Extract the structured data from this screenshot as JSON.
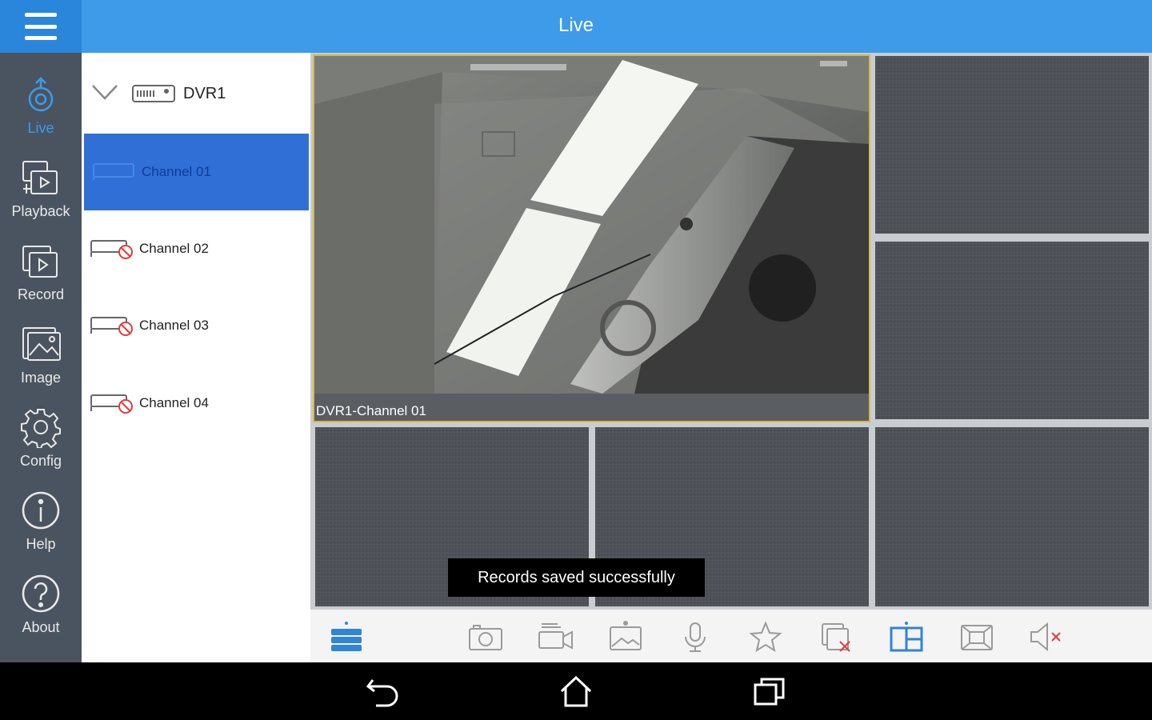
{
  "header": {
    "title": "Live"
  },
  "sidebar": {
    "items": [
      {
        "label": "Live",
        "icon": "camera-icon",
        "active": true
      },
      {
        "label": "Playback",
        "icon": "playback-icon"
      },
      {
        "label": "Record",
        "icon": "record-icon"
      },
      {
        "label": "Image",
        "icon": "image-icon"
      },
      {
        "label": "Config",
        "icon": "gear-icon"
      },
      {
        "label": "Help",
        "icon": "info-icon"
      },
      {
        "label": "About",
        "icon": "question-icon"
      }
    ]
  },
  "device_list": {
    "dvr_name": "DVR1",
    "channels": [
      {
        "name": "Channel 01",
        "selected": true
      },
      {
        "name": "Channel 02",
        "offline": true
      },
      {
        "name": "Channel 03",
        "offline": true
      },
      {
        "name": "Channel 04",
        "offline": true
      }
    ]
  },
  "video": {
    "main_caption": "DVR1-Channel 01"
  },
  "toast": {
    "message": "Records saved successfully"
  },
  "toolbar": {
    "icons": [
      "stream-quality-icon",
      "snapshot-icon",
      "record-video-icon",
      "image-icon",
      "microphone-icon",
      "favorite-star-icon",
      "close-all-icon",
      "split-layout-icon",
      "fullscreen-icon",
      "mute-icon"
    ]
  },
  "colors": {
    "accent": "#3d9be9",
    "nav_bg": "#4a5460",
    "selected": "#2f6fd6",
    "highlight_border": "#d8b84a"
  }
}
